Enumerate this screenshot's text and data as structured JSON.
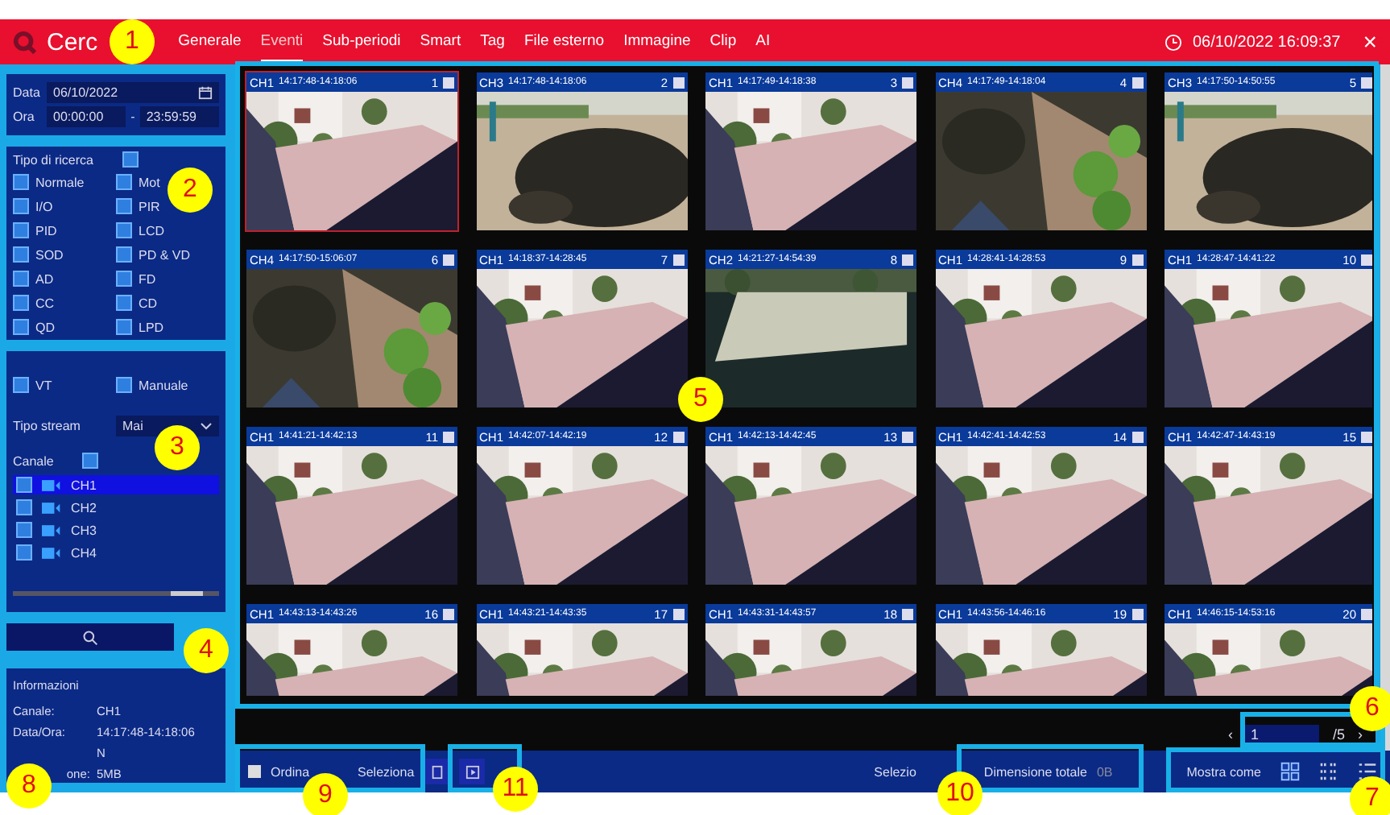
{
  "header": {
    "title": "Cerc",
    "tabs": [
      {
        "label": "Generale",
        "selected": false
      },
      {
        "label": "Eventi",
        "selected": true
      },
      {
        "label": "Sub-periodi",
        "selected": false
      },
      {
        "label": "Smart",
        "selected": false
      },
      {
        "label": "Tag",
        "selected": false
      },
      {
        "label": "File esterno",
        "selected": false
      },
      {
        "label": "Immagine",
        "selected": false
      },
      {
        "label": "Clip",
        "selected": false
      },
      {
        "label": "AI",
        "selected": false
      }
    ],
    "datetime": "06/10/2022 16:09:37",
    "close": "×"
  },
  "filters": {
    "date_label": "Data",
    "date": "06/10/2022",
    "time_label": "Ora",
    "time_from": "00:00:00",
    "time_sep": "-",
    "time_to": "23:59:59",
    "search_type_label": "Tipo di ricerca",
    "search_type_all": true,
    "types": [
      {
        "label": "Normale",
        "checked": true
      },
      {
        "label": "Mot",
        "checked": true
      },
      {
        "label": "I/O",
        "checked": true
      },
      {
        "label": "PIR",
        "checked": true
      },
      {
        "label": "PID",
        "checked": true
      },
      {
        "label": "LCD",
        "checked": true
      },
      {
        "label": "SOD",
        "checked": true
      },
      {
        "label": "PD & VD",
        "checked": true
      },
      {
        "label": "AD",
        "checked": true
      },
      {
        "label": "FD",
        "checked": true
      },
      {
        "label": "CC",
        "checked": true
      },
      {
        "label": "CD",
        "checked": true
      },
      {
        "label": "QD",
        "checked": true
      },
      {
        "label": "LPD",
        "checked": true
      }
    ],
    "types_more": [
      {
        "label": "VT",
        "checked": true
      },
      {
        "label": "Manuale",
        "checked": true
      }
    ],
    "stream_label": "Tipo stream",
    "stream_value": "Mai",
    "channel_label": "Canale",
    "channel_all": true,
    "channels": [
      {
        "label": "CH1",
        "checked": true,
        "selected": true
      },
      {
        "label": "CH2",
        "checked": true,
        "selected": false
      },
      {
        "label": "CH3",
        "checked": true,
        "selected": false
      },
      {
        "label": "CH4",
        "checked": true,
        "selected": false
      }
    ]
  },
  "info": {
    "title": "Informazioni",
    "rows": [
      {
        "label": "Canale:",
        "value": "CH1"
      },
      {
        "label": "Data/Ora:",
        "value": "14:17:48-14:18:06"
      },
      {
        "value": "N"
      },
      {
        "label": "one:",
        "value": "5MB"
      }
    ]
  },
  "clips": [
    {
      "channel": "CH1",
      "time": "14:17:48-14:18:06",
      "number": "1",
      "checked": false,
      "selected": true
    },
    {
      "channel": "CH3",
      "time": "14:17:48-14:18:06",
      "number": "2",
      "checked": false,
      "selected": false
    },
    {
      "channel": "CH1",
      "time": "14:17:49-14:18:38",
      "number": "3",
      "checked": false,
      "selected": false
    },
    {
      "channel": "CH4",
      "time": "14:17:49-14:18:04",
      "number": "4",
      "checked": false,
      "selected": false
    },
    {
      "channel": "CH3",
      "time": "14:17:50-14:50:55",
      "number": "5",
      "checked": false,
      "selected": false
    },
    {
      "channel": "CH4",
      "time": "14:17:50-15:06:07",
      "number": "6",
      "checked": false,
      "selected": false
    },
    {
      "channel": "CH1",
      "time": "14:18:37-14:28:45",
      "number": "7",
      "checked": false,
      "selected": false
    },
    {
      "channel": "CH2",
      "time": "14:21:27-14:54:39",
      "number": "8",
      "checked": false,
      "selected": false
    },
    {
      "channel": "CH1",
      "time": "14:28:41-14:28:53",
      "number": "9",
      "checked": false,
      "selected": false
    },
    {
      "channel": "CH1",
      "time": "14:28:47-14:41:22",
      "number": "10",
      "checked": false,
      "selected": false
    },
    {
      "channel": "CH1",
      "time": "14:41:21-14:42:13",
      "number": "11",
      "checked": false,
      "selected": false
    },
    {
      "channel": "CH1",
      "time": "14:42:07-14:42:19",
      "number": "12",
      "checked": false,
      "selected": false
    },
    {
      "channel": "CH1",
      "time": "14:42:13-14:42:45",
      "number": "13",
      "checked": false,
      "selected": false
    },
    {
      "channel": "CH1",
      "time": "14:42:41-14:42:53",
      "number": "14",
      "checked": false,
      "selected": false
    },
    {
      "channel": "CH1",
      "time": "14:42:47-14:43:19",
      "number": "15",
      "checked": false,
      "selected": false
    },
    {
      "channel": "CH1",
      "time": "14:43:13-14:43:26",
      "number": "16",
      "checked": false,
      "selected": false
    },
    {
      "channel": "CH1",
      "time": "14:43:21-14:43:35",
      "number": "17",
      "checked": false,
      "selected": false
    },
    {
      "channel": "CH1",
      "time": "14:43:31-14:43:57",
      "number": "18",
      "checked": false,
      "selected": false
    },
    {
      "channel": "CH1",
      "time": "14:43:56-14:46:16",
      "number": "19",
      "checked": false,
      "selected": false
    },
    {
      "channel": "CH1",
      "time": "14:46:15-14:53:16",
      "number": "20",
      "checked": false,
      "selected": false
    }
  ],
  "pager": {
    "prev": "‹",
    "page": "1",
    "total": "/5",
    "next": "›"
  },
  "footer": {
    "sort_label": "Ordina",
    "sort_checked": false,
    "select_label": "Seleziona",
    "selected_label": "Selezio",
    "total_label": "Dimensione totale",
    "total_value": "0B",
    "view_label": "Mostra come"
  },
  "callouts": [
    {
      "label": "1"
    },
    {
      "label": "2"
    },
    {
      "label": "3"
    },
    {
      "label": "4"
    },
    {
      "label": "5"
    },
    {
      "label": "6"
    },
    {
      "label": "7"
    },
    {
      "label": "8"
    },
    {
      "label": "9"
    },
    {
      "label": "11"
    },
    {
      "label": "10"
    }
  ]
}
